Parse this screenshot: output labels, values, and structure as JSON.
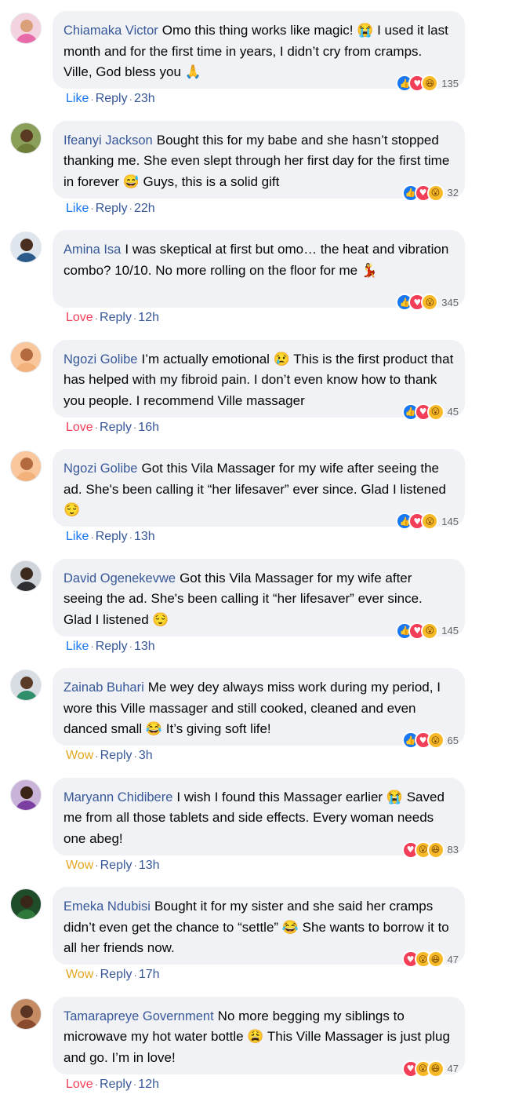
{
  "comments": [
    {
      "author": "Chiamaka Victor",
      "text": "Omo this thing works like magic! 😭 I used it last month and for the first time in years, I didn’t cry from cramps. Ville, God bless you 🙏",
      "reactions": [
        "like",
        "love",
        "haha"
      ],
      "count": "135",
      "action": "Like",
      "action_color": "#1877f2",
      "reply": "Reply",
      "time": "23h",
      "avatar_colors": [
        "#d9a07a",
        "#e86aa8",
        "#f4d3e0"
      ]
    },
    {
      "author": "Ifeanyi Jackson",
      "text": "Bought this for my babe and she hasn’t stopped thanking me. She even slept through her first day for the first time in forever 😅 Guys, this is a solid gift",
      "reactions": [
        "like",
        "love",
        "wow"
      ],
      "count": "32",
      "action": "Like",
      "action_color": "#1877f2",
      "reply": "Reply",
      "time": "22h",
      "avatar_colors": [
        "#5a3a22",
        "#6f7d3a",
        "#8aa05a"
      ]
    },
    {
      "author": "Amina Isa",
      "text": "I was skeptical at first but omo… the heat and vibration combo? 10/10. No more rolling on the floor for me 💃",
      "reactions": [
        "like",
        "love",
        "wow"
      ],
      "count": "345",
      "action": "Love",
      "action_color": "#f33e58",
      "reply": "Reply",
      "time": "12h",
      "avatar_colors": [
        "#4a2e1f",
        "#2c5a8a",
        "#dfe6ee"
      ]
    },
    {
      "author": "Ngozi Golibe",
      "text": "I’m actually emotional 😢 This is the first product that has helped with my fibroid pain. I don’t even know how to thank you people. I recommend Ville massager",
      "reactions": [
        "like",
        "love",
        "wow"
      ],
      "count": "45",
      "action": "Love",
      "action_color": "#f33e58",
      "reply": "Reply",
      "time": "16h",
      "avatar_colors": [
        "#b36a3e",
        "#f2b27a",
        "#f9c79b"
      ]
    },
    {
      "author": "Ngozi Golibe",
      "text": "Got this Vila Massager for my wife after seeing the ad. She's been calling it “her lifesaver” ever since. Glad I listened 😌",
      "reactions": [
        "like",
        "love",
        "wow"
      ],
      "count": "145",
      "action": "Like",
      "action_color": "#1877f2",
      "reply": "Reply",
      "time": "13h",
      "avatar_colors": [
        "#b36a3e",
        "#f2b27a",
        "#f9c79b"
      ]
    },
    {
      "author": "David Ogenekevwe",
      "text": "Got this Vila Massager for my wife after seeing the ad. She's been calling it “her lifesaver” ever since. Glad I listened 😌",
      "reactions": [
        "like",
        "love",
        "wow"
      ],
      "count": "145",
      "action": "Like",
      "action_color": "#1877f2",
      "reply": "Reply",
      "time": "13h",
      "avatar_colors": [
        "#3d2a1e",
        "#2f2f33",
        "#cfd4da"
      ]
    },
    {
      "author": "Zainab Buhari",
      "text": "Me wey dey always miss work during my period, I wore this Ville massager and still cooked, cleaned and even danced small 😂 It’s giving soft life!",
      "reactions": [
        "like",
        "love",
        "wow"
      ],
      "count": "65",
      "action": "Wow",
      "action_color": "#e5a823",
      "reply": "Reply",
      "time": "3h",
      "avatar_colors": [
        "#5a3b28",
        "#2f8f6a",
        "#d7dde3"
      ]
    },
    {
      "author": "Maryann Chidibere",
      "text": "I wish I found this Massager earlier 😭 Saved me from all those tablets and side effects. Every woman needs one abeg!",
      "reactions": [
        "love",
        "wow",
        "haha"
      ],
      "count": "83",
      "action": "Wow",
      "action_color": "#e5a823",
      "reply": "Reply",
      "time": "13h",
      "avatar_colors": [
        "#3b2416",
        "#7a3fa0",
        "#c9b3d8"
      ]
    },
    {
      "author": "Emeka Ndubisi",
      "text": "Bought it for my sister and she said her cramps didn’t even get the chance to “settle” 😂 She wants to borrow it to all her friends now.",
      "reactions": [
        "love",
        "wow",
        "haha"
      ],
      "count": "47",
      "action": "Wow",
      "action_color": "#e5a823",
      "reply": "Reply",
      "time": "17h",
      "avatar_colors": [
        "#3a2619",
        "#2f7a3a",
        "#1f4d2a"
      ]
    },
    {
      "author": "Tamarapreye Government",
      "text": "No more begging my siblings to microwave my hot water bottle 😩 This Ville Massager is just plug and go. I’m in love!",
      "reactions": [
        "love",
        "wow",
        "haha"
      ],
      "count": "47",
      "action": "Love",
      "action_color": "#f33e58",
      "reply": "Reply",
      "time": "12h",
      "avatar_colors": [
        "#5b3524",
        "#8a4a2d",
        "#c58b62"
      ]
    }
  ]
}
